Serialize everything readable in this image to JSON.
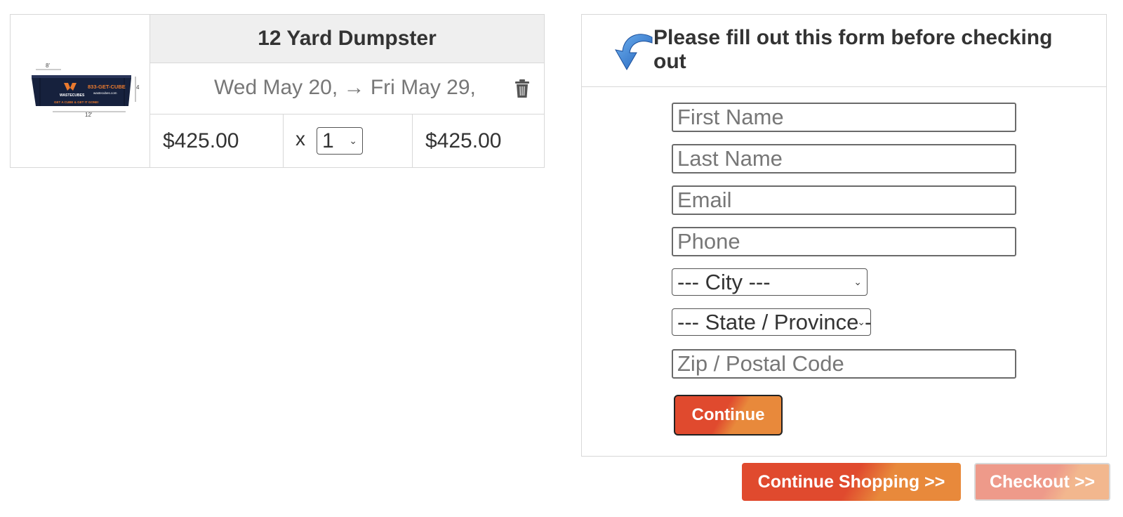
{
  "cart": {
    "product_title": "12 Yard Dumpster",
    "product_image": {
      "icon": "dumpster-image",
      "dim_width": "8'",
      "dim_length": "12'",
      "dim_height": "4'",
      "phone": "833-GET-CUBE",
      "brand": "WASTECUBES",
      "site": "wastecubes.com",
      "slogan": "GET A CUBE & GET IT GONE!"
    },
    "dates": "Wed May 20, → Fri May 29,",
    "unit_price": "$425.00",
    "qty_label": "x",
    "qty_value": "1",
    "line_total": "$425.00"
  },
  "form": {
    "heading": "Please fill out this form before checking out",
    "first_name_placeholder": "First Name",
    "last_name_placeholder": "Last Name",
    "email_placeholder": "Email",
    "phone_placeholder": "Phone",
    "city_selected": "--- City ---",
    "state_selected": "--- State / Province ---",
    "zip_placeholder": "Zip / Postal Code",
    "continue_label": "Continue"
  },
  "actions": {
    "continue_shopping_label": "Continue Shopping >>",
    "checkout_label": "Checkout >>"
  },
  "colors": {
    "accent_red": "#e04a2e",
    "accent_orange": "#e8893b",
    "arrow_blue": "#2f7fd6"
  }
}
